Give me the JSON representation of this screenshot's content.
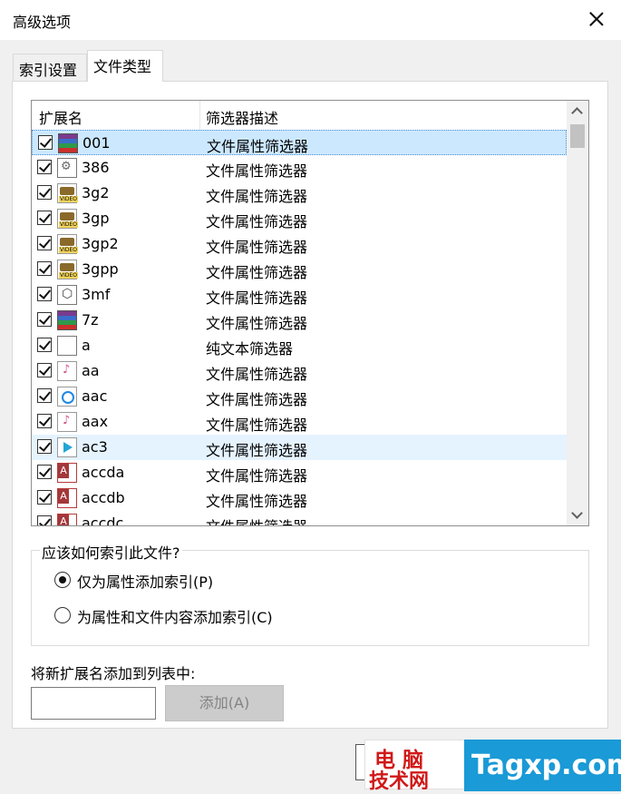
{
  "window": {
    "title": "高级选项"
  },
  "tabs": [
    {
      "label": "索引设置"
    },
    {
      "label": "文件类型"
    }
  ],
  "list": {
    "columns": {
      "ext": "扩展名",
      "desc": "筛选器描述"
    },
    "rows": [
      {
        "ext": "001",
        "desc": "文件属性筛选器",
        "icon": "archive-icon",
        "checked": true
      },
      {
        "ext": "386",
        "desc": "文件属性筛选器",
        "icon": "gear-file-icon",
        "checked": true
      },
      {
        "ext": "3g2",
        "desc": "文件属性筛选器",
        "icon": "video-file-icon",
        "checked": true
      },
      {
        "ext": "3gp",
        "desc": "文件属性筛选器",
        "icon": "video-file-icon",
        "checked": true
      },
      {
        "ext": "3gp2",
        "desc": "文件属性筛选器",
        "icon": "video-file-icon",
        "checked": true
      },
      {
        "ext": "3gpp",
        "desc": "文件属性筛选器",
        "icon": "video-file-icon",
        "checked": true
      },
      {
        "ext": "3mf",
        "desc": "文件属性筛选器",
        "icon": "3d-cube-icon",
        "checked": true
      },
      {
        "ext": "7z",
        "desc": "文件属性筛选器",
        "icon": "archive-icon",
        "checked": true
      },
      {
        "ext": "a",
        "desc": "纯文本筛选器",
        "icon": "generic-file-icon",
        "checked": true
      },
      {
        "ext": "aa",
        "desc": "文件属性筛选器",
        "icon": "audio-file-icon",
        "checked": true
      },
      {
        "ext": "aac",
        "desc": "文件属性筛选器",
        "icon": "aac-audio-icon",
        "checked": true
      },
      {
        "ext": "aax",
        "desc": "文件属性筛选器",
        "icon": "audio-file-icon",
        "checked": true
      },
      {
        "ext": "ac3",
        "desc": "文件属性筛选器",
        "icon": "media-play-icon",
        "checked": true
      },
      {
        "ext": "accda",
        "desc": "文件属性筛选器",
        "icon": "access-file-icon",
        "checked": true
      },
      {
        "ext": "accdb",
        "desc": "文件属性筛选器",
        "icon": "access-file-icon",
        "checked": true
      },
      {
        "ext": "accdc",
        "desc": "文件属性筛选器",
        "icon": "access-file-icon",
        "checked": true
      }
    ]
  },
  "index_group": {
    "label": "应该如何索引此文件?",
    "options": [
      {
        "label": "仅为属性添加索引(P)",
        "selected": true
      },
      {
        "label": "为属性和文件内容添加索引(C)",
        "selected": false
      }
    ]
  },
  "add_extension": {
    "label": "将新扩展名添加到列表中:",
    "input_value": "",
    "button_label": "添加(A)"
  },
  "watermark": {
    "line1": "电脑",
    "line2": "技术网",
    "brand": "Tagxp.com"
  }
}
